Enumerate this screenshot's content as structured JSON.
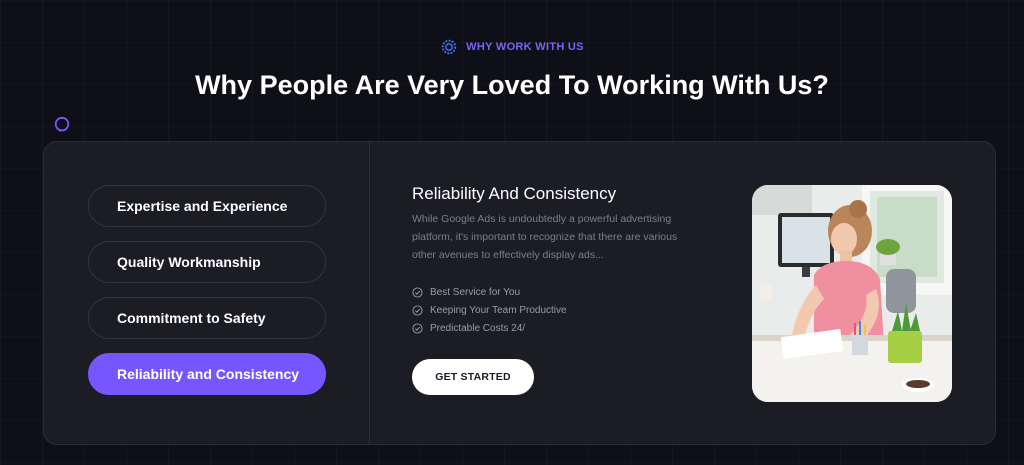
{
  "header": {
    "eyebrow_icon": "sparkle-ring-icon",
    "eyebrow": "WHY WORK WITH US",
    "title": "Why People Are Very Loved To Working With Us?"
  },
  "tabs": [
    {
      "label": "Expertise and Experience",
      "active": false
    },
    {
      "label": "Quality Workmanship",
      "active": false
    },
    {
      "label": "Commitment to Safety",
      "active": false
    },
    {
      "label": "Reliability and Consistency",
      "active": true
    }
  ],
  "panel": {
    "title": "Reliability And Consistency",
    "description": "While Google Ads is undoubtedly a powerful advertising platform, it's important to recognize that there are various other avenues to effectively display ads...",
    "checklist_icon": "check-circle-icon",
    "checklist": [
      "Best Service for You",
      "Keeping Your Team Productive",
      "Predictable Costs 24/"
    ],
    "cta_label": "GET STARTED"
  },
  "colors": {
    "background": "#0f1017",
    "card": "#1b1c24",
    "accent": "#7657ff",
    "muted_text": "#7c7e8a"
  }
}
